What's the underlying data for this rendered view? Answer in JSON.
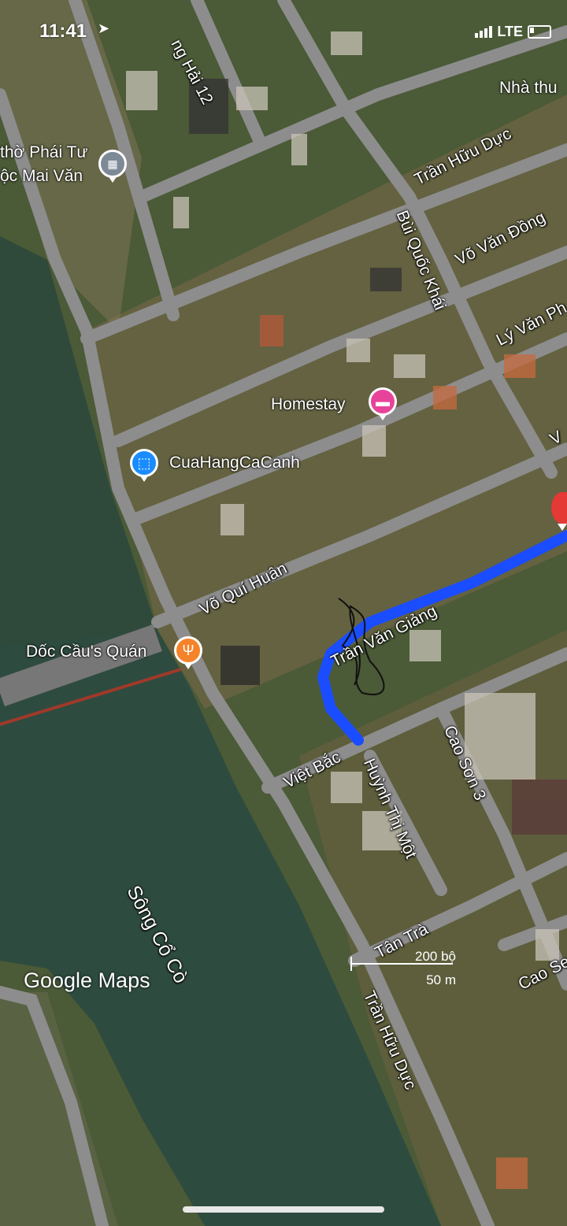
{
  "status_bar": {
    "time": "11:41",
    "network": "LTE"
  },
  "roads": [
    "ng Hải 12",
    "Trần Hữu Dực",
    "Bùi Quốc Khái",
    "Võ Văn Đồng",
    "Lý Văn Ph",
    "Võ Quí Huân",
    "Trần Văn Giảng",
    "Việt Bắc",
    "Huỳnh Thị Một",
    "Cao Sơn 3",
    "Tân Trà",
    "Trần Hữu Dực",
    "Cao Se",
    "V"
  ],
  "places": {
    "temple_line1": "thờ Phái Tư",
    "temple_line2": "ộc Mai Văn",
    "nha_thu": "Nhà thu",
    "homestay": "Homestay",
    "shop": "CuaHangCaCanh",
    "restaurant": "Dốc Cầu's Quán"
  },
  "river": "Sông Cổ Cò",
  "branding": "Google Maps",
  "scale": {
    "imperial": "200 bộ",
    "metric": "50 m"
  },
  "icons": [
    "temple-icon",
    "hotel-icon",
    "shopping-icon",
    "restaurant-icon",
    "destination-pin-icon"
  ],
  "colors": {
    "route": "#1a4dff",
    "hotel": "#e8439a",
    "shop": "#1a8cff",
    "restaurant": "#f5832a",
    "destination": "#e53935"
  }
}
